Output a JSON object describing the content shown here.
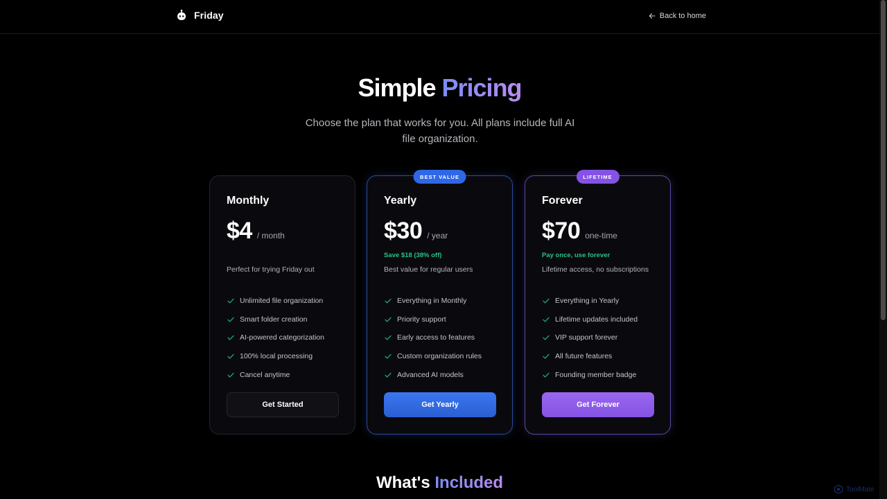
{
  "header": {
    "brand_name": "Friday",
    "back_label": "Back to home"
  },
  "hero": {
    "title_part1": "Simple",
    "title_part2": "Pricing",
    "subtitle": "Choose the plan that works for you. All plans include full AI file organization."
  },
  "plans": [
    {
      "name": "Monthly",
      "price": "$4",
      "period": "/ month",
      "savings": "",
      "description": "Perfect for trying Friday out",
      "features": [
        "Unlimited file organization",
        "Smart folder creation",
        "AI-powered categorization",
        "100% local processing",
        "Cancel anytime"
      ],
      "cta": "Get Started"
    },
    {
      "name": "Yearly",
      "badge": "BEST VALUE",
      "price": "$30",
      "period": "/ year",
      "savings": "Save $18 (38% off)",
      "description": "Best value for regular users",
      "features": [
        "Everything in Monthly",
        "Priority support",
        "Early access to features",
        "Custom organization rules",
        "Advanced AI models"
      ],
      "cta": "Get Yearly"
    },
    {
      "name": "Forever",
      "badge": "LIFETIME",
      "price": "$70",
      "period": "one-time",
      "savings": "Pay once, use forever",
      "description": "Lifetime access, no subscriptions",
      "features": [
        "Everything in Yearly",
        "Lifetime updates included",
        "VIP support forever",
        "All future features",
        "Founding member badge"
      ],
      "cta": "Get Forever"
    }
  ],
  "included": {
    "title_part1": "What's",
    "title_part2": "Included"
  },
  "watermark": {
    "text": "ToolMate"
  },
  "colors": {
    "background": "#000000",
    "accent_blue": "#2f68e6",
    "accent_purple": "#8452e6",
    "savings_green": "#28c184",
    "check_green": "#22b07a"
  }
}
